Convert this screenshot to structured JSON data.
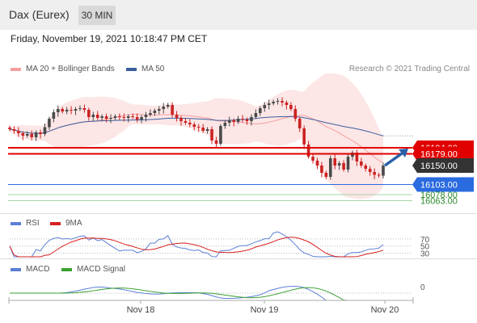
{
  "header": {
    "title": "Dax (Eurex)",
    "timeframe": "30 MIN"
  },
  "datetime": "Friday, November 19, 2021 10:18:47 PM CET",
  "credit": "Research © 2021 Trading Central",
  "colors": {
    "ma20": "#f5a0a0",
    "ma50": "#3a5f9e",
    "resistance": "#e00000",
    "support": "#2a6be0",
    "target": "#2e8b2e",
    "arrow": "#2a5fa8",
    "up": "#4a4a4a",
    "down": "#cc2222",
    "rsi": "#5b7fd6",
    "rsi_ma": "#d62020",
    "macd": "#5b7fd6",
    "macd_signal": "#3aa030"
  },
  "chart_data": [
    {
      "type": "candlestick",
      "legend": [
        {
          "name": "MA 20 + Bollinger Bands",
          "color": "#f5a0a0"
        },
        {
          "name": "MA 50",
          "color": "#3a5f9e"
        }
      ],
      "ylim": [
        16040,
        16440
      ],
      "levels": [
        {
          "label": "16194.00",
          "value": 16194,
          "color": "#e00000",
          "style": "box"
        },
        {
          "label": "16179.00",
          "value": 16179,
          "color": "#e00000",
          "style": "box"
        },
        {
          "label": "16150.00",
          "value": 16150,
          "color": "#333333",
          "style": "box"
        },
        {
          "label": "16103.00",
          "value": 16103,
          "color": "#2a6be0",
          "style": "box"
        },
        {
          "label": "16078.00",
          "value": 16078,
          "color": "#2e8b2e",
          "style": "text"
        },
        {
          "label": "16063.00",
          "value": 16063,
          "color": "#2e8b2e",
          "style": "text"
        }
      ],
      "close": [
        16240,
        16236,
        16230,
        16224,
        16228,
        16220,
        16232,
        16228,
        16245,
        16266,
        16282,
        16290,
        16284,
        16288,
        16286,
        16290,
        16292,
        16288,
        16270,
        16276,
        16268,
        16272,
        16266,
        16268,
        16272,
        16270,
        16268,
        16272,
        16270,
        16264,
        16270,
        16276,
        16280,
        16286,
        16290,
        16296,
        16300,
        16276,
        16268,
        16260,
        16256,
        16252,
        16246,
        16244,
        16236,
        16240,
        16212,
        16204,
        16248,
        16256,
        16262,
        16258,
        16266,
        16264,
        16260,
        16270,
        16280,
        16292,
        16300,
        16304,
        16308,
        16310,
        16306,
        16300,
        16290,
        16266,
        16242,
        16202,
        16172,
        16162,
        16150,
        16132,
        16122,
        16168,
        16150,
        16156,
        16140,
        16172,
        16182,
        16160,
        16150,
        16142,
        16134,
        16127,
        16125,
        16150
      ],
      "x_ticks": [
        "Nov 18",
        "Nov 19",
        "Nov 20"
      ]
    },
    {
      "type": "line",
      "legend": [
        {
          "name": "RSI",
          "color": "#5b7fd6"
        },
        {
          "name": "9MA",
          "color": "#d62020"
        }
      ],
      "levels": [
        "70",
        "50",
        "30"
      ]
    },
    {
      "type": "line",
      "legend": [
        {
          "name": "MACD",
          "color": "#5b7fd6"
        },
        {
          "name": "MACD Signal",
          "color": "#3aa030"
        }
      ],
      "levels": [
        "0"
      ]
    }
  ]
}
